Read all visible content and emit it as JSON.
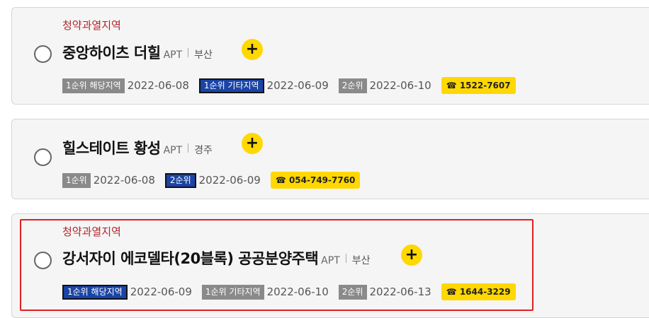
{
  "listings": [
    {
      "region_tag": "청약과열지역",
      "title": "중앙하이츠 더힐",
      "type": "APT",
      "location": "부산",
      "plus": "+",
      "schedule": [
        {
          "label": "1순위 해당지역",
          "date": "2022-06-08",
          "active": false
        },
        {
          "label": "1순위 기타지역",
          "date": "2022-06-09",
          "active": true
        },
        {
          "label": "2순위",
          "date": "2022-06-10",
          "active": false
        }
      ],
      "phone": "☎ 1522-7607"
    },
    {
      "region_tag": "",
      "title": "힐스테이트 황성",
      "type": "APT",
      "location": "경주",
      "plus": "+",
      "schedule": [
        {
          "label": "1순위",
          "date": "2022-06-08",
          "active": false
        },
        {
          "label": "2순위",
          "date": "2022-06-09",
          "active": true
        }
      ],
      "phone": "☎ 054-749-7760"
    },
    {
      "region_tag": "청약과열지역",
      "title": "강서자이 에코델타(20블록) 공공분양주택",
      "type": "APT",
      "location": "부산",
      "plus": "+",
      "schedule": [
        {
          "label": "1순위 해당지역",
          "date": "2022-06-09",
          "active": true
        },
        {
          "label": "1순위 기타지역",
          "date": "2022-06-10",
          "active": false
        },
        {
          "label": "2순위",
          "date": "2022-06-13",
          "active": false
        }
      ],
      "phone": "☎ 1644-3229"
    }
  ],
  "colors": {
    "region_tag": "#b0252c",
    "badge_active": "#1a44a6",
    "badge_inactive": "#8a8a8a",
    "accent_yellow": "#ffd800",
    "highlight_border": "#e01e1e"
  }
}
